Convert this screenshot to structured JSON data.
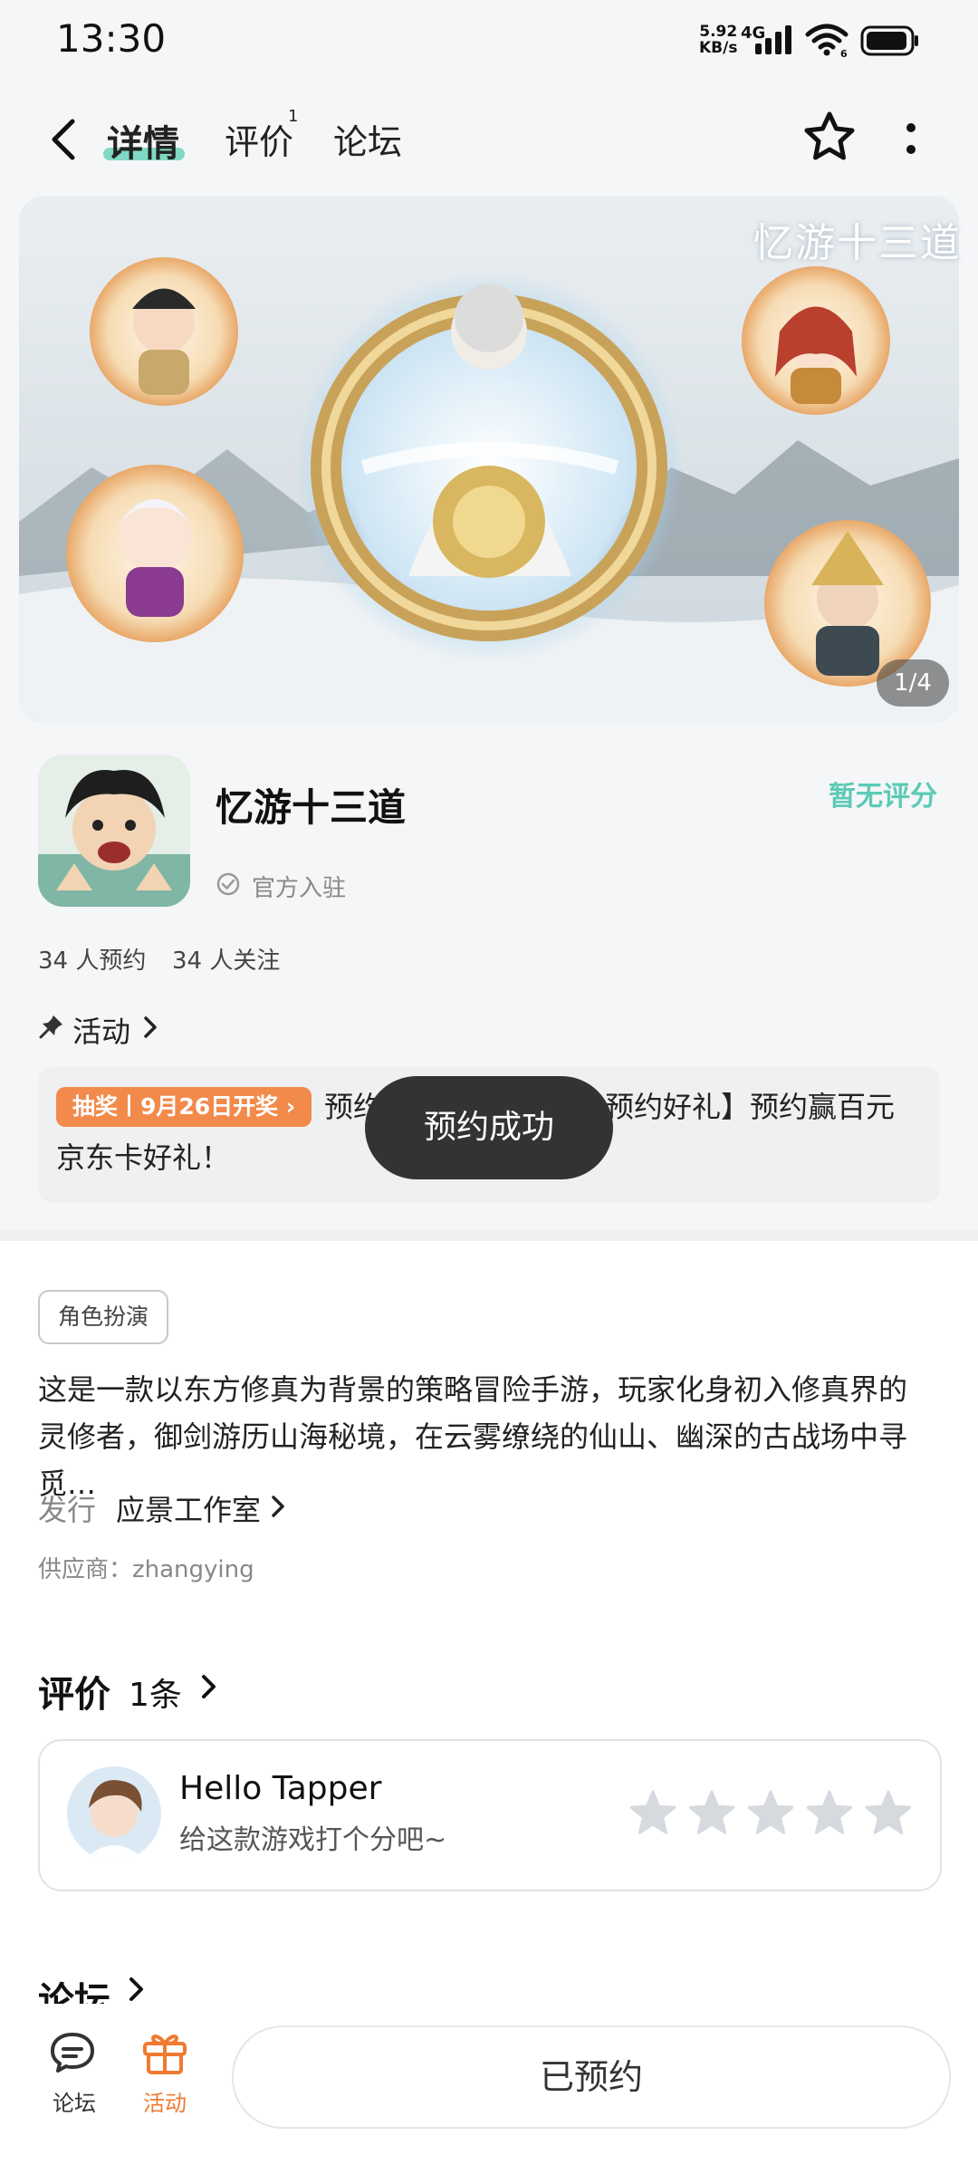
{
  "status_bar": {
    "time": "13:30",
    "net_speed_value": "5.92",
    "net_speed_unit": "KB/s",
    "net_type": "4G",
    "wifi_sub": "6"
  },
  "nav": {
    "tab_details": "详情",
    "tab_reviews": "评价",
    "tab_reviews_count": "1",
    "tab_forum": "论坛"
  },
  "banner": {
    "overlay_title": "忆游十三道",
    "page_indicator": "1/4"
  },
  "game": {
    "title": "忆游十三道",
    "rating": "暂无评分",
    "official": "官方入驻",
    "reservations": "34 人预约",
    "followers": "34 人关注"
  },
  "activity": {
    "label": "活动",
    "badge": "抽奖丨9月26日开奖",
    "text_start": "预约",
    "text_end": "预约好礼】预约赢百元",
    "text_line2": "京东卡好礼！"
  },
  "toast": "预约成功",
  "details": {
    "tag": "角色扮演",
    "description": "这是一款以东方修真为背景的策略冒险手游，玩家化身初入修真界的灵修者，御剑游历山海秘境，在云雾缭绕的仙山、幽深的古战场中寻觅…",
    "publisher_label": "发行",
    "publisher": "应景工作室",
    "supplier": "供应商：zhangying"
  },
  "reviews": {
    "title": "评价",
    "count": "1条",
    "user_name": "Hello Tapper",
    "hint": "给这款游戏打个分吧~",
    "star_count": 5
  },
  "forum": {
    "title": "论坛"
  },
  "bottom_bar": {
    "forum": "论坛",
    "activity": "活动",
    "reserve_button": "已预约"
  },
  "colors": {
    "accent": "#5ccab5",
    "tab_underline": "#7fd9c4",
    "badge_orange": "#f28a4b",
    "activity_orange": "#f07a32"
  }
}
